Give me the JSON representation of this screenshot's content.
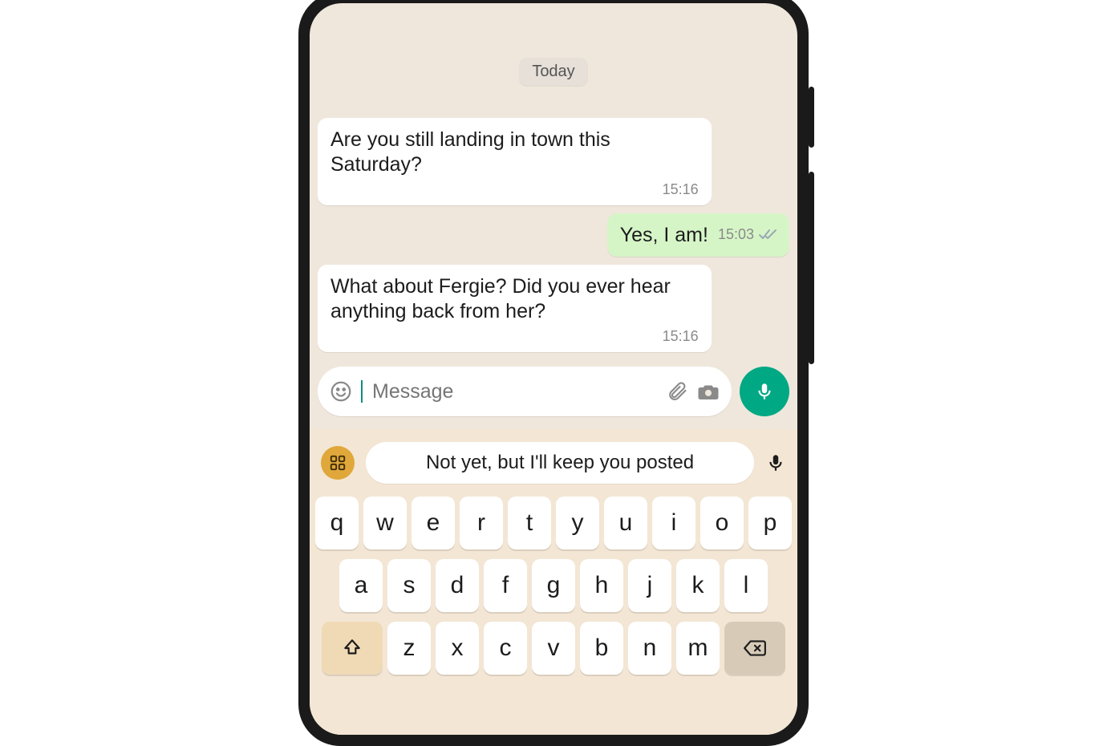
{
  "date_label": "Today",
  "messages": {
    "m0": {
      "text": "Are you still landing in town this Saturday?",
      "time": "15:16"
    },
    "m1": {
      "text": "Yes, I am!",
      "time": "15:03"
    },
    "m2": {
      "text": "What about Fergie? Did you ever hear anything back from her?",
      "time": "15:16"
    }
  },
  "composer": {
    "placeholder": "Message"
  },
  "suggestion": {
    "text": "Not yet, but I'll keep you posted"
  },
  "keyboard": {
    "row1": [
      "q",
      "w",
      "e",
      "r",
      "t",
      "y",
      "u",
      "i",
      "o",
      "p"
    ],
    "row2": [
      "a",
      "s",
      "d",
      "f",
      "g",
      "h",
      "j",
      "k",
      "l"
    ],
    "row3": [
      "z",
      "x",
      "c",
      "v",
      "b",
      "n",
      "m"
    ]
  },
  "colors": {
    "accent": "#00a884",
    "bubble_out": "#d6f5c7"
  }
}
